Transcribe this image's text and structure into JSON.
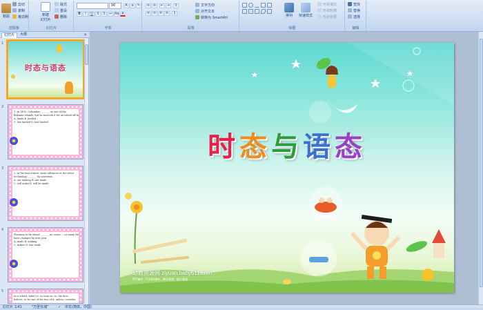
{
  "ribbon": {
    "clipboard": {
      "paste": "粘贴",
      "cut": "剪切",
      "copy": "复制",
      "format_painter": "格式刷",
      "label": "剪贴板"
    },
    "slides": {
      "new_slide": "新建\n幻灯片",
      "layout": "版式",
      "reset": "重设",
      "delete": "删除",
      "label": "幻灯片"
    },
    "font": {
      "font_name": "",
      "font_size": "96",
      "label": "字体"
    },
    "paragraph": {
      "label": "段落",
      "text_direction": "文字方向",
      "align_text": "对齐文本",
      "smartart": "转换为 SmartArt"
    },
    "drawing": {
      "arrange": "排列",
      "quick_styles": "快速样式",
      "shape_fill": "形状填充",
      "shape_outline": "形状轮廓",
      "shape_effects": "形状效果",
      "label": "绘图"
    },
    "editing": {
      "find": "查找",
      "replace": "替换",
      "select": "选择",
      "label": "编辑"
    }
  },
  "left_pane": {
    "tab_slides": "幻灯片",
    "tab_outline": "大纲",
    "close": "×",
    "thumbnails": [
      {
        "number": "1",
        "title": "时态与语态"
      },
      {
        "number": "2",
        "lines": [
          "1. In 1492, Columbus _______ on one of the",
          "Bahama Islands, but he mistook it for an island off India",
          "A. lands          B. landed",
          "C. has landed     D. had landed"
        ]
      },
      {
        "number": "3",
        "lines": [
          "2. In the near future, more advances in the robot",
          "technology _______ by scientists",
          "A. are making     B. are made",
          "C. will make      D. will be made"
        ]
      },
      {
        "number": "4",
        "lines": [
          "Planning to fix ahead _______ no cause — or many things",
          "have changed by next year",
          "A. made          B. making",
          "C. makes         D. has made"
        ]
      },
      {
        "number": "5",
        "lines": [
          "In a school, label (s), so soon as, to, the face,",
          "believe, to be one of the two of it, unless, consider"
        ]
      }
    ]
  },
  "slide": {
    "title_chars": [
      "时",
      "态",
      "与",
      "语",
      "态"
    ],
    "title_colors": [
      "#e8204a",
      "#f28a1c",
      "#2b9e3a",
      "#3b6fd1",
      "#9b3fc8"
    ],
    "website": "幼教资源网 ziyuan.baby611.com",
    "website_sub": "PPT课件、FLASH课件、教学视频、图片素材"
  },
  "status_bar": {
    "slide_info": "幻灯片 1/41",
    "theme": "\"万圣长城\"",
    "language": "中文(简体，中国)"
  },
  "colors": {
    "ribbon_bg": "#cfdff3",
    "pane_bg": "#dbe7f5",
    "workspace_bg": "#aebed3",
    "selection": "#f5a623",
    "thumb_frame": "#f8b7d8"
  }
}
